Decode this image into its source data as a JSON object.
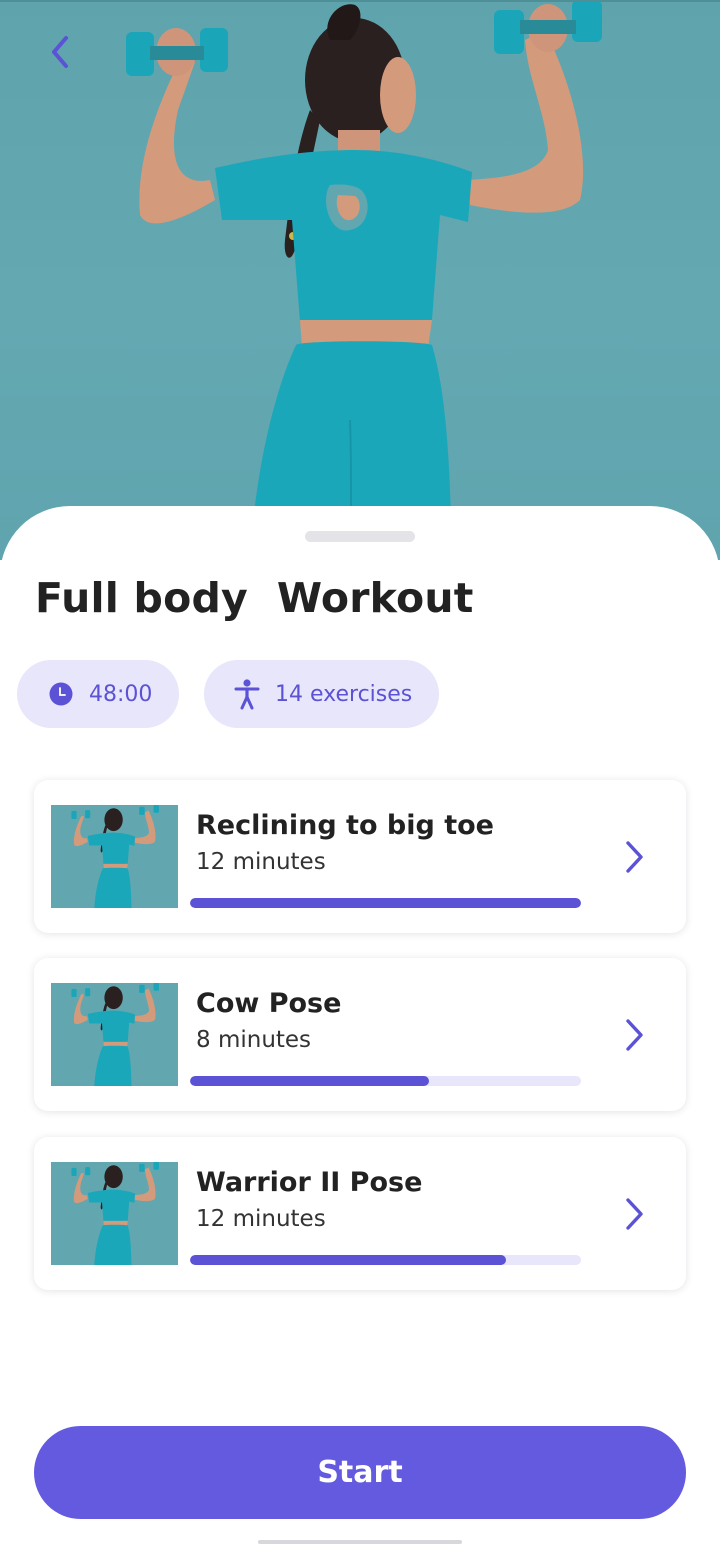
{
  "workout": {
    "title": "Full body  Workout",
    "duration": "48:00",
    "exercise_count": "14 exercises"
  },
  "icons": {
    "back": "chevron-left-icon",
    "duration": "clock-icon",
    "exercises": "person-icon",
    "item_action": "chevron-right-icon"
  },
  "colors": {
    "accent": "#5b52d6",
    "button": "#635ae0",
    "chip_bg": "#e8e6fa",
    "hero_bg": "#62a7b0"
  },
  "exercises": [
    {
      "name": "Reclining to big toe",
      "duration": "12 minutes",
      "progress": 1.0
    },
    {
      "name": "Cow Pose",
      "duration": "8 minutes",
      "progress": 0.61
    },
    {
      "name": "Warrior II Pose",
      "duration": "12 minutes",
      "progress": 0.807
    }
  ],
  "start_label": "Start"
}
